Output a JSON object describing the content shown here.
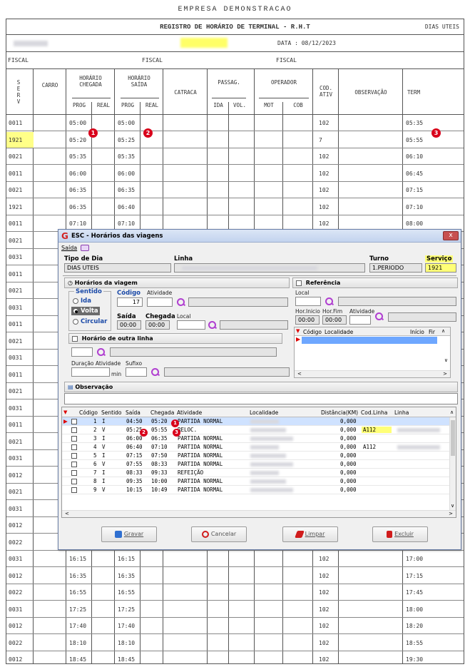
{
  "report": {
    "company": "EMPRESA DEMONSTRACAO",
    "title": "REGISTRO DE HORÁRIO DE TERMINAL - R.H.T",
    "day_type": "DIAS UTEIS",
    "data_label": "DATA : 08/12/2023",
    "fiscal_label": "FISCAL",
    "headers": {
      "serv": "S\nE\nR\nV",
      "carro": "CARRO",
      "horario_chegada": "HORÁRIO\nCHEGADA",
      "horario_saida": "HORÁRIO\nSAÍDA",
      "prog": "PROG",
      "real": "REAL",
      "catraca": "CATRACA",
      "passag": "PASSAG.",
      "ida": "IDA",
      "vol": "VOL.",
      "operador": "OPERADOR",
      "mot": "MOT",
      "cob": "COB",
      "cod_ativ": "COD.\nATIV",
      "observacao": "OBSERVAÇÃO",
      "term": "TERM"
    },
    "rows": [
      {
        "serv": "0011",
        "chegada": "05:00",
        "saida": "05:00",
        "cod": "102",
        "term": "05:35"
      },
      {
        "serv": "1921",
        "chegada": "05:20",
        "saida": "05:25",
        "cod": "7",
        "term": "05:55"
      },
      {
        "serv": "0021",
        "chegada": "05:35",
        "saida": "05:35",
        "cod": "102",
        "term": "06:10"
      },
      {
        "serv": "0011",
        "chegada": "06:00",
        "saida": "06:00",
        "cod": "102",
        "term": "06:45"
      },
      {
        "serv": "0021",
        "chegada": "06:35",
        "saida": "06:35",
        "cod": "102",
        "term": "07:15"
      },
      {
        "serv": "1921",
        "chegada": "06:35",
        "saida": "06:40",
        "cod": "102",
        "term": "07:10"
      },
      {
        "serv": "0011",
        "chegada": "07:10",
        "saida": "07:10",
        "cod": "102",
        "term": "08:00"
      },
      {
        "serv": "0021",
        "chegada": "",
        "saida": "",
        "cod": "",
        "term": ""
      },
      {
        "serv": "0031",
        "chegada": "",
        "saida": "",
        "cod": "",
        "term": ""
      },
      {
        "serv": "0011",
        "chegada": "",
        "saida": "",
        "cod": "",
        "term": ""
      },
      {
        "serv": "0021",
        "chegada": "",
        "saida": "",
        "cod": "",
        "term": ""
      },
      {
        "serv": "0031",
        "chegada": "",
        "saida": "",
        "cod": "",
        "term": ""
      },
      {
        "serv": "0011",
        "chegada": "",
        "saida": "",
        "cod": "",
        "term": ""
      },
      {
        "serv": "0021",
        "chegada": "",
        "saida": "",
        "cod": "",
        "term": ""
      },
      {
        "serv": "0031",
        "chegada": "",
        "saida": "",
        "cod": "",
        "term": ""
      },
      {
        "serv": "0011",
        "chegada": "",
        "saida": "",
        "cod": "",
        "term": ""
      },
      {
        "serv": "0021",
        "chegada": "",
        "saida": "",
        "cod": "",
        "term": ""
      },
      {
        "serv": "0031",
        "chegada": "",
        "saida": "",
        "cod": "",
        "term": ""
      },
      {
        "serv": "0011",
        "chegada": "",
        "saida": "",
        "cod": "",
        "term": ""
      },
      {
        "serv": "0021",
        "chegada": "",
        "saida": "",
        "cod": "",
        "term": ""
      },
      {
        "serv": "0031",
        "chegada": "",
        "saida": "",
        "cod": "",
        "term": ""
      },
      {
        "serv": "0012",
        "chegada": "",
        "saida": "",
        "cod": "",
        "term": ""
      },
      {
        "serv": "0021",
        "chegada": "",
        "saida": "",
        "cod": "",
        "term": ""
      },
      {
        "serv": "0031",
        "chegada": "",
        "saida": "",
        "cod": "",
        "term": ""
      },
      {
        "serv": "0012",
        "chegada": "",
        "saida": "",
        "cod": "",
        "term": ""
      },
      {
        "serv": "0022",
        "chegada": "",
        "saida": "",
        "cod": "",
        "term": ""
      },
      {
        "serv": "0031",
        "chegada": "16:15",
        "saida": "16:15",
        "cod": "102",
        "term": "17:00"
      },
      {
        "serv": "0012",
        "chegada": "16:35",
        "saida": "16:35",
        "cod": "102",
        "term": "17:15"
      },
      {
        "serv": "0022",
        "chegada": "16:55",
        "saida": "16:55",
        "cod": "102",
        "term": "17:45"
      },
      {
        "serv": "0031",
        "chegada": "17:25",
        "saida": "17:25",
        "cod": "102",
        "term": "18:00"
      },
      {
        "serv": "0012",
        "chegada": "17:40",
        "saida": "17:40",
        "cod": "102",
        "term": "18:20"
      },
      {
        "serv": "0022",
        "chegada": "18:10",
        "saida": "18:10",
        "cod": "102",
        "term": "18:55"
      },
      {
        "serv": "0012",
        "chegada": "18:45",
        "saida": "18:45",
        "cod": "102",
        "term": "19:30"
      }
    ],
    "markers": [
      "1",
      "2",
      "3"
    ]
  },
  "dialog": {
    "title": "ESC - Horários das viagens",
    "logo": "G",
    "close": "x",
    "menu_saida": "Saída",
    "tipo_dia_label": "Tipo de Dia",
    "tipo_dia_value": "DIAS UTEIS",
    "linha_label": "Linha",
    "turno_label": "Turno",
    "turno_value": "1.PERIODO",
    "servico_label": "Serviço",
    "servico_value": "1921",
    "horarios_group": "Horários da viagem",
    "sentido_label": "Sentido",
    "radio_ida": "Ida",
    "radio_volta": "Volta",
    "radio_circular": "Circular",
    "codigo_label": "Código",
    "codigo_value": "17",
    "atividade_label": "Atividade",
    "saida_label": "Saída",
    "saida_value": "00:00",
    "chegada_label": "Chegada",
    "chegada_value": "00:00",
    "local_label": "Local",
    "outra_linha": "Horário de outra linha",
    "duracao_label": "Duração Atividade",
    "min_label": "min",
    "sufixo_label": "Sufixo",
    "observacao_label": "Observação",
    "referencia_label": "Referência",
    "ref_local_label": "Local",
    "hor_inicio_label": "Hor.Inicio",
    "hor_inicio_value": "00:00",
    "hor_fim_label": "Hor.Fim",
    "hor_fim_value": "00:00",
    "ref_atividade_label": "Atividade",
    "mini_headers": [
      "Código",
      "Localidade",
      "Início",
      "Fir"
    ],
    "grid_headers": [
      "Código",
      "Sentido",
      "Saída",
      "Chegada",
      "Atividade",
      "Localidade",
      "Distância(KM)",
      "Cod.Linha",
      "Linha"
    ],
    "grid_rows": [
      {
        "codigo": "1",
        "sentido": "I",
        "saida": "04:50",
        "chegada": "05:20",
        "atividade": "PARTIDA NORMAL",
        "dist": "0,000",
        "codlinha": ""
      },
      {
        "codigo": "2",
        "sentido": "V",
        "saida": "05:25",
        "chegada": "05:55",
        "atividade": "RELOC.",
        "dist": "0,000",
        "codlinha": "A112"
      },
      {
        "codigo": "3",
        "sentido": "I",
        "saida": "06:00",
        "chegada": "06:35",
        "atividade": "PARTIDA NORMAL",
        "dist": "0,000",
        "codlinha": ""
      },
      {
        "codigo": "4",
        "sentido": "V",
        "saida": "06:40",
        "chegada": "07:10",
        "atividade": "PARTIDA NORMAL",
        "dist": "0,000",
        "codlinha": "A112"
      },
      {
        "codigo": "5",
        "sentido": "I",
        "saida": "07:15",
        "chegada": "07:50",
        "atividade": "PARTIDA NORMAL",
        "dist": "0,000",
        "codlinha": ""
      },
      {
        "codigo": "6",
        "sentido": "V",
        "saida": "07:55",
        "chegada": "08:33",
        "atividade": "PARTIDA NORMAL",
        "dist": "0,000",
        "codlinha": ""
      },
      {
        "codigo": "7",
        "sentido": "I",
        "saida": "08:33",
        "chegada": "09:33",
        "atividade": "REFEIÇÃO",
        "dist": "0,000",
        "codlinha": ""
      },
      {
        "codigo": "8",
        "sentido": "I",
        "saida": "09:35",
        "chegada": "10:00",
        "atividade": "PARTIDA NORMAL",
        "dist": "0,000",
        "codlinha": ""
      },
      {
        "codigo": "9",
        "sentido": "V",
        "saida": "10:15",
        "chegada": "10:49",
        "atividade": "PARTIDA NORMAL",
        "dist": "0,000",
        "codlinha": ""
      }
    ],
    "buttons": {
      "gravar": "Gravar",
      "cancelar": "Cancelar",
      "limpar": "Limpar",
      "excluir": "Excluir"
    }
  }
}
